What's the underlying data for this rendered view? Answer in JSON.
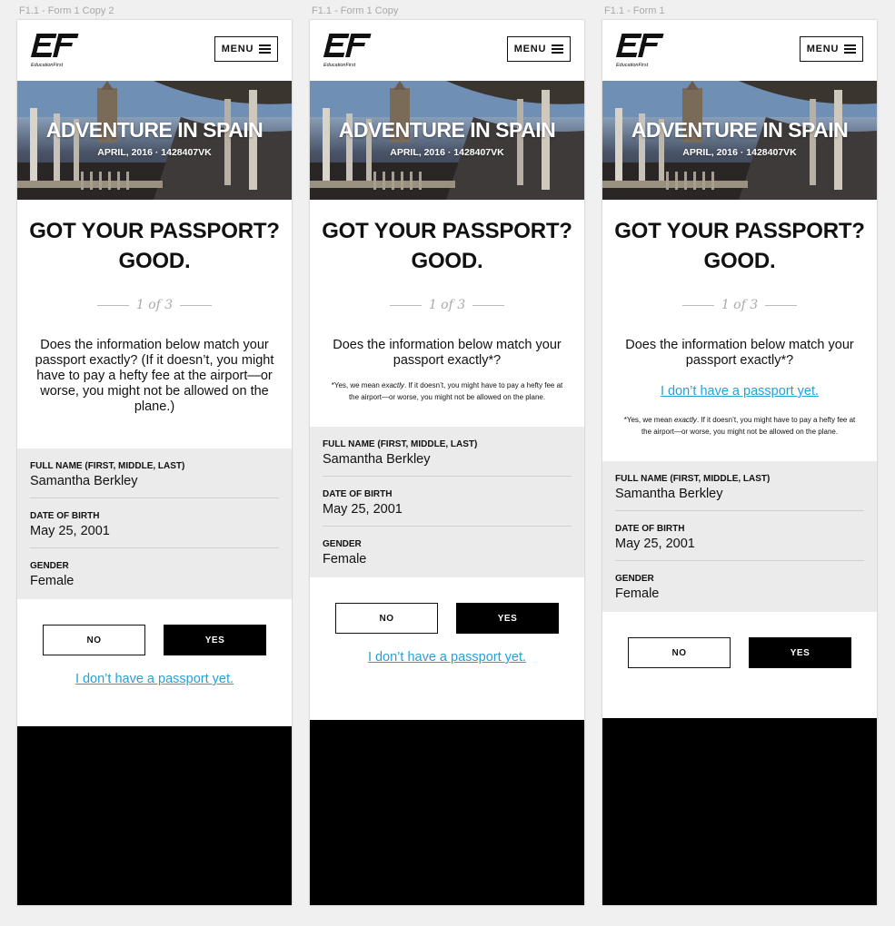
{
  "artboards": [
    {
      "label": "F1.1 - Form 1 Copy 2"
    },
    {
      "label": "F1.1 - Form 1 Copy"
    },
    {
      "label": "F1.1 - Form 1"
    }
  ],
  "header": {
    "menu_label": "MENU",
    "logo_text": "EducationFirst"
  },
  "hero": {
    "title": "ADVENTURE IN SPAIN",
    "subtitle": "APRIL, 2016 · 1428407VK"
  },
  "heading": {
    "line1": "GOT YOUR PASSPORT?",
    "line2": "GOOD."
  },
  "step": "1 of 3",
  "question_long": "Does the information below match your passport exactly? (If it doesn’t, you might have to pay a hefty fee at the airport—or worse, you might not be allowed on the plane.)",
  "question_short": "Does the information below match your passport exactly*?",
  "note": {
    "prefix": "*Yes, we mean ",
    "emphasis": "exactly",
    "suffix": ". If it doesn’t, you might have to pay a hefty fee at the airport—or worse, you might not be allowed on the plane."
  },
  "fields": [
    {
      "label": "FULL NAME (FIRST, MIDDLE, LAST)",
      "value": "Samantha Berkley"
    },
    {
      "label": "DATE OF BIRTH",
      "value": "May 25, 2001"
    },
    {
      "label": "GENDER",
      "value": "Female"
    }
  ],
  "buttons": {
    "no": "NO",
    "yes": "YES"
  },
  "no_passport_link": "I don’t have a passport yet."
}
